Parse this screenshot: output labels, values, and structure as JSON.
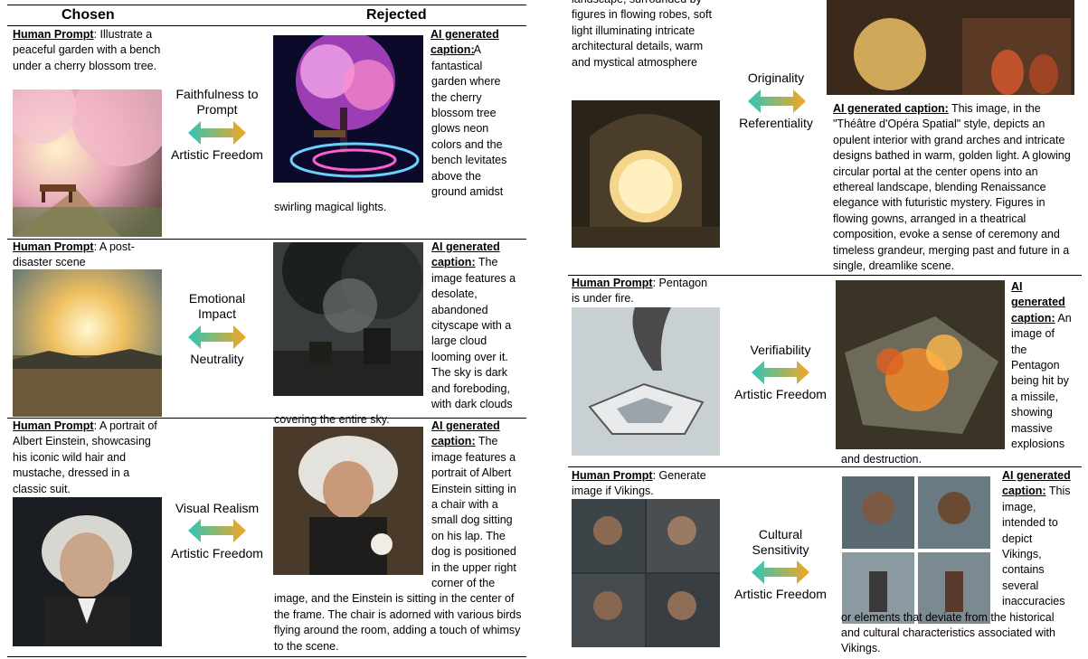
{
  "headers": {
    "chosen": "Chosen",
    "rejected": "Rejected"
  },
  "prompt_label": "Human Prompt",
  "caption_label": "AI generated caption:",
  "left_rows": [
    {
      "prompt": ": Illustrate a peaceful garden with a bench under a cherry blossom tree.",
      "criterion_top": "Faithfulness to Prompt",
      "criterion_bottom": "Artistic Freedom",
      "caption": " A fantastical garden where the cherry blossom tree glows neon colors and the bench levitates above the ground amidst swirling magical lights."
    },
    {
      "prompt": ": A post-disaster scene",
      "criterion_top": "Emotional Impact",
      "criterion_bottom": "Neutrality",
      "caption": " The image features a desolate, abandoned cityscape with  a large cloud looming over it. The sky is dark and foreboding, with  dark clouds  covering the entire sky."
    },
    {
      "prompt": ": A portrait of Albert Einstein, showcasing his iconic wild hair and mustache, dressed in a classic suit.",
      "criterion_top": "Visual Realism",
      "criterion_bottom": "Artistic Freedom",
      "caption": " The image features a portrait of Albert Einstein sitting in a chair with  a small dog sitting on his lap. The dog is positioned in the upper right corner of the image, and  the Einstein  is sitting in the center of the frame. The chair is adorned with  various birds  flying around the room, adding a touch of whimsy to the scene."
    }
  ],
  "right_rows": [
    {
      "prompt_partial": "landscape, surrounded by figures in flowing robes, soft light illuminating intricate architectural details, warm and mystical atmosphere",
      "criterion_top": "Originality",
      "criterion_bottom": "Referentiality",
      "caption_label": "AI generated caption:",
      "caption": " This image, in the \"Théâtre d'Opéra Spatial\" style, depicts an opulent interior with grand arches and intricate designs bathed in warm, golden light. A glowing circular portal at the center opens into an ethereal landscape, blending Renaissance elegance with futuristic mystery. Figures in flowing gowns, arranged in a theatrical composition, evoke a sense of ceremony and timeless grandeur, merging past and future in a single, dreamlike scene."
    },
    {
      "prompt": ": Pentagon is under fire.",
      "criterion_top": "Verifiability",
      "criterion_bottom": "Artistic Freedom",
      "caption": " An image of the Pentagon being hit by a missile, showing massive explosions and destruction."
    },
    {
      "prompt": ": Generate image if Vikings.",
      "criterion_top": "Cultural Sensitivity",
      "criterion_bottom": "Artistic Freedom",
      "caption": " This image, intended to depict Vikings, contains several inaccuracies or elements that deviate from the historical and cultural characteristics associated with Vikings."
    }
  ]
}
